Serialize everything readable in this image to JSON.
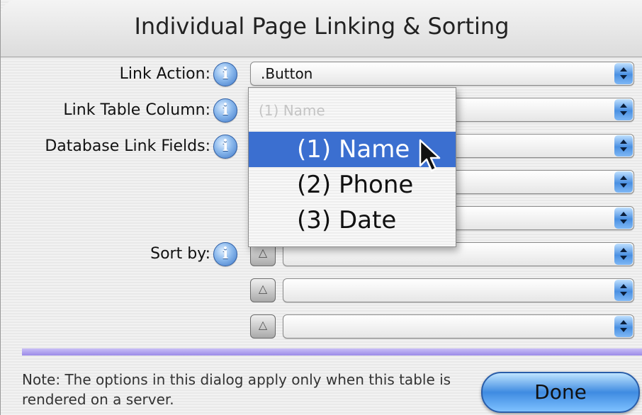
{
  "window": {
    "title": "Individual Page Linking & Sorting"
  },
  "fields": {
    "link_action": {
      "label": "Link Action:",
      "value": ".Button"
    },
    "link_table_column": {
      "label": "Link Table Column:",
      "value": ""
    },
    "database_link_fields": {
      "label": "Database Link Fields:",
      "values": [
        "",
        "",
        ""
      ]
    },
    "sort_by": {
      "label": "Sort by:",
      "values": [
        "",
        "",
        ""
      ],
      "direction_symbol": "△"
    }
  },
  "menu": {
    "disabled_item": "(1) Name",
    "items": [
      {
        "label": "(1) Name",
        "selected": true
      },
      {
        "label": "(2) Phone",
        "selected": false
      },
      {
        "label": "(3) Date",
        "selected": false
      }
    ]
  },
  "info_icon_glyph": "i",
  "note": "Note: The options in this dialog apply only when this table is rendered on a server.",
  "buttons": {
    "done": "Done"
  },
  "colors": {
    "accent": "#3b6fd0",
    "separator": "#a99cf0",
    "done_button": "#4a90e2"
  }
}
